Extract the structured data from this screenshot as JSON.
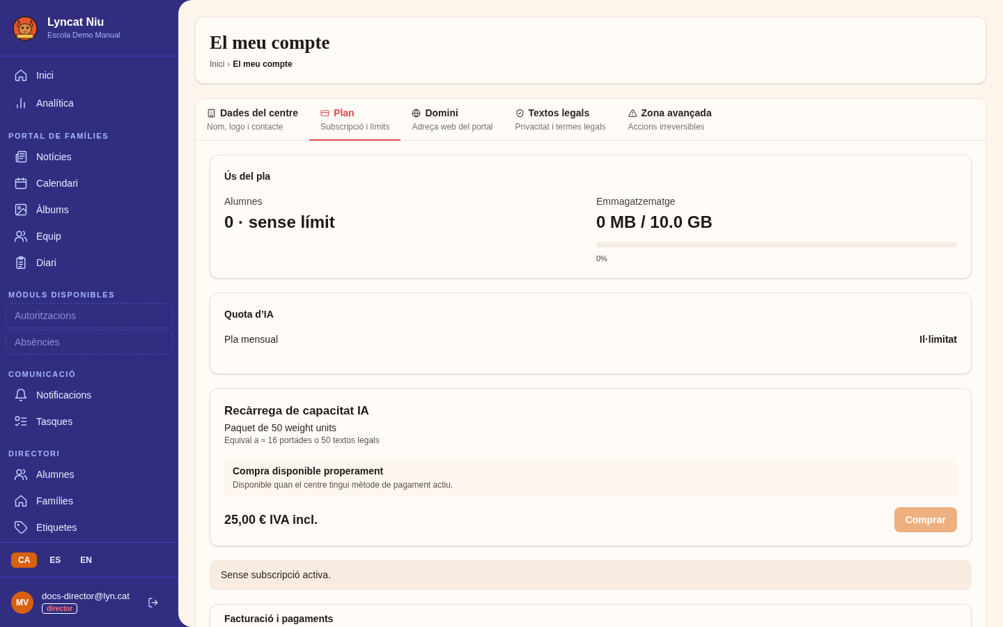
{
  "sidebar": {
    "brand": {
      "name": "Lyncat Niu",
      "subtitle": "Escola Demo Manual"
    },
    "sections": [
      {
        "items": [
          {
            "label": "Inici",
            "disabled": false
          },
          {
            "label": "Analítica",
            "disabled": false
          }
        ]
      },
      {
        "title": "PORTAL DE FAMÍLIES",
        "items": [
          {
            "label": "Notícies",
            "disabled": false
          },
          {
            "label": "Calendari",
            "disabled": false
          },
          {
            "label": "Àlbums",
            "disabled": false
          },
          {
            "label": "Equip",
            "disabled": false
          },
          {
            "label": "Diari",
            "disabled": false
          }
        ]
      },
      {
        "title": "MÒDULS DISPONIBLES",
        "items": [
          {
            "label": "Autoritzacions",
            "disabled": true
          },
          {
            "label": "Absències",
            "disabled": true
          }
        ]
      },
      {
        "title": "COMUNICACIÓ",
        "items": [
          {
            "label": "Notificacions",
            "disabled": false
          },
          {
            "label": "Tasques",
            "disabled": false
          }
        ]
      },
      {
        "title": "DIRECTORI",
        "items": [
          {
            "label": "Alumnes",
            "disabled": false
          },
          {
            "label": "Famílies",
            "disabled": false
          },
          {
            "label": "Etiquetes",
            "disabled": false
          }
        ]
      }
    ],
    "languages": [
      {
        "code": "CA",
        "selected": true
      },
      {
        "code": "ES",
        "selected": false
      },
      {
        "code": "EN",
        "selected": false
      }
    ],
    "user": {
      "initials": "MV",
      "email": "docs-director@lyn.cat",
      "role": "director"
    }
  },
  "header": {
    "title": "El meu compte",
    "breadcrumb": [
      {
        "label": "Inici",
        "current": false
      },
      {
        "label": "El meu compte",
        "current": true
      }
    ],
    "separator": "›"
  },
  "tabs": [
    {
      "label": "Dades del centre",
      "subtitle": "Nom, logo i contacte",
      "selected": false
    },
    {
      "label": "Plan",
      "subtitle": "Subscripció i límits",
      "selected": true
    },
    {
      "label": "Domini",
      "subtitle": "Adreça web del portal",
      "selected": false
    },
    {
      "label": "Textos legals",
      "subtitle": "Privacitat i termes legals",
      "selected": false
    },
    {
      "label": "Zona avançada",
      "subtitle": "Accions irreversibles",
      "selected": false
    }
  ],
  "plan_usage": {
    "title": "Ús del pla",
    "metrics": [
      {
        "kind": "count",
        "label": "Alumnes",
        "value": "0 · sense límit"
      },
      {
        "kind": "meter",
        "label": "Emmagatzematge",
        "value": "0 MB / 10.0 GB",
        "level": 0,
        "reading": "0%"
      }
    ]
  },
  "ai_quota": {
    "title": "Quota d’IA",
    "rows": [
      {
        "label": "Pla mensual",
        "value": "Il·limitat"
      }
    ]
  },
  "recharge": {
    "title": "Recàrrega de capacitat IA",
    "package": "Paquet de 50 weight units",
    "equivalence": "Equival a ≈ 16 portades o 50 textos legals",
    "notice": {
      "title": "Compra disponible properament",
      "text": "Disponible quan el centre tingui mètode de pagament actiu."
    },
    "price": "25,00 € IVA incl.",
    "button": {
      "label": "Comprar",
      "disabled": true
    }
  },
  "alert": {
    "text": "Sense subscripció activa."
  },
  "billing": {
    "title": "Facturació i pagaments"
  }
}
